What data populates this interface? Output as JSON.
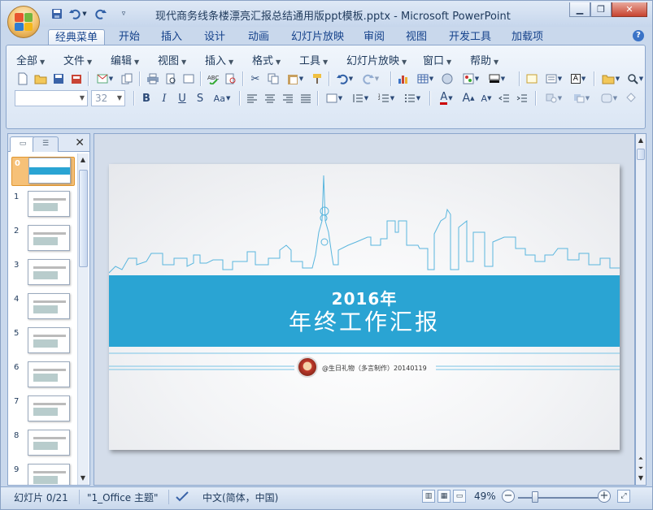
{
  "window": {
    "title": "现代商务线条楼漂亮汇报总结通用版ppt模板.pptx - Microsoft PowerPoint",
    "controls": [
      "minimize",
      "maximize",
      "close"
    ]
  },
  "quick_access": [
    "save-icon",
    "undo-icon",
    "redo-icon",
    "customize-icon"
  ],
  "ribbon_tabs": [
    "经典菜单",
    "开始",
    "插入",
    "设计",
    "动画",
    "幻灯片放映",
    "审阅",
    "视图",
    "开发工具",
    "加载项"
  ],
  "active_tab": "经典菜单",
  "classic_menu": [
    "全部",
    "文件",
    "编辑",
    "视图",
    "插入",
    "格式",
    "工具",
    "幻灯片放映",
    "窗口",
    "帮助"
  ],
  "toolbar": {
    "font_name": "",
    "font_size": "32"
  },
  "slides_panel": {
    "tabs": [
      "slides-tab",
      "outline-tab"
    ],
    "numbers": [
      "0",
      "1",
      "2",
      "3",
      "4",
      "5",
      "6",
      "7",
      "8",
      "9"
    ],
    "selected": 0
  },
  "slide": {
    "year": "2016年",
    "title": "年终工作汇报",
    "credit": "@生日礼物（多言制作）20140119",
    "colors": {
      "band": "#2aa4d3",
      "skyline": "#5ab6de"
    }
  },
  "status": {
    "slide_counter": "幻灯片 0/21",
    "theme": "\"1_Office 主题\"",
    "language": "中文(简体，中国)",
    "zoom": "49%"
  }
}
